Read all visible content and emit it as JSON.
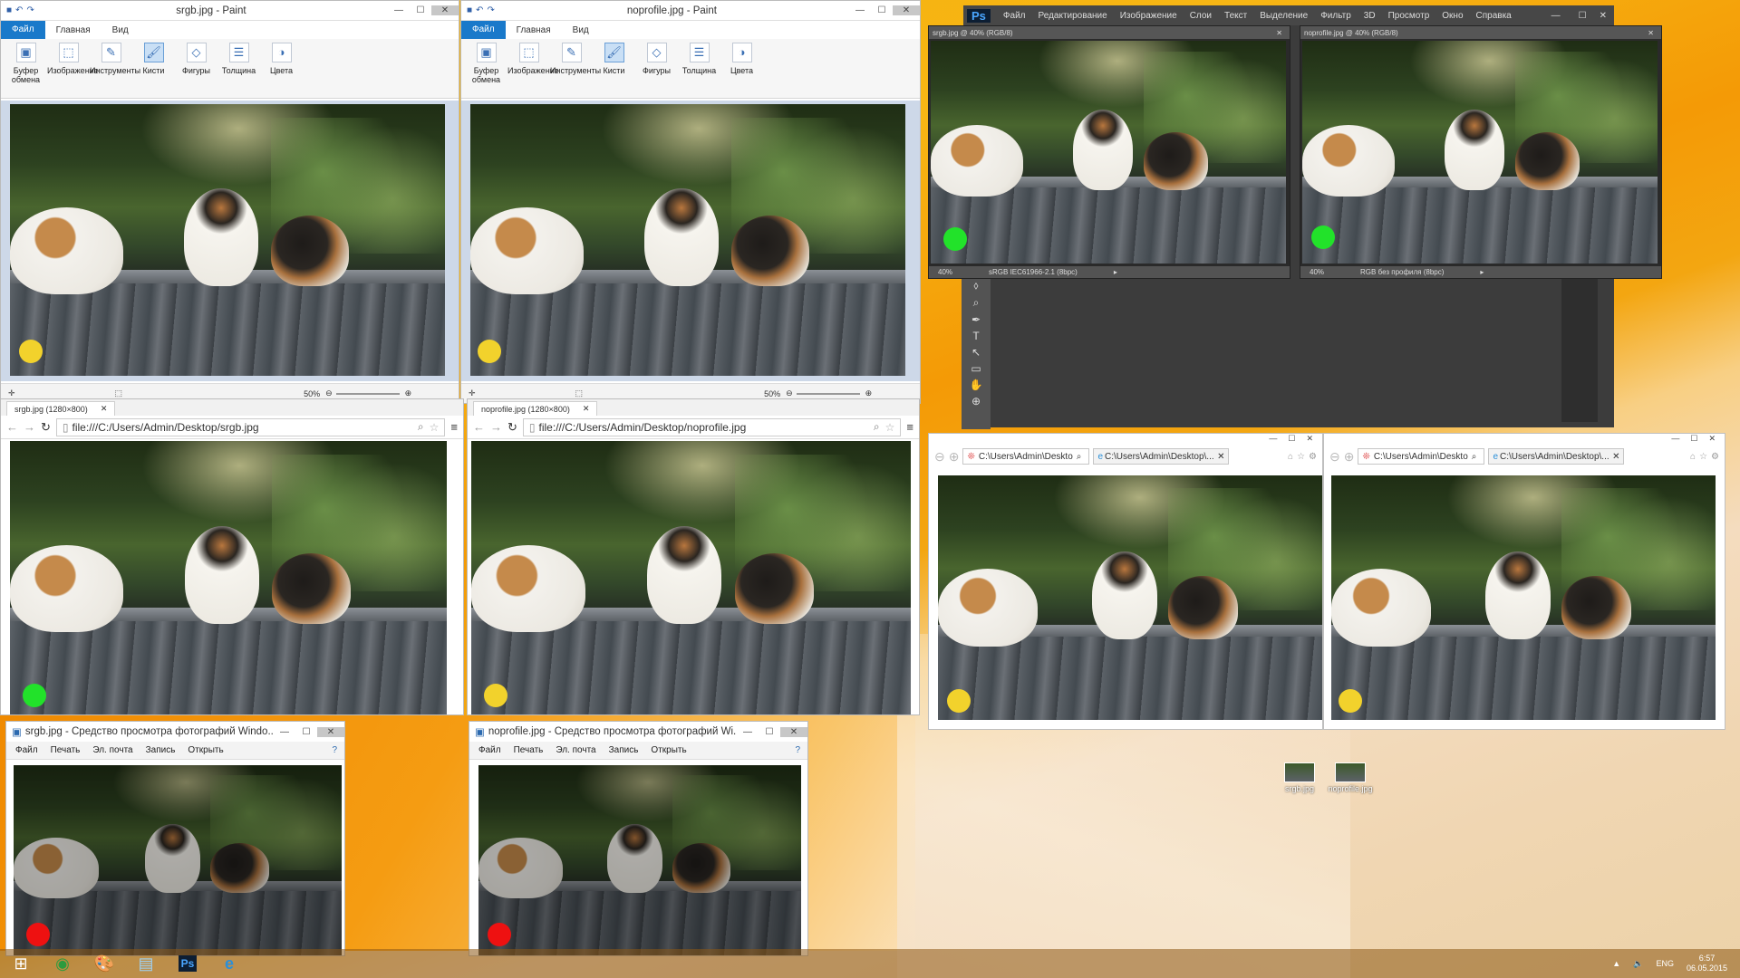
{
  "paint": [
    {
      "title": "srgb.jpg - Paint",
      "dot": "#f2d22c"
    },
    {
      "title": "noprofile.jpg - Paint",
      "dot": "#f2d22c"
    }
  ],
  "paint_tabs": {
    "file": "Файл",
    "home": "Главная",
    "view": "Вид"
  },
  "paint_ribbon": [
    {
      "icon": "clipboard-icon",
      "label": "Буфер обмена"
    },
    {
      "icon": "image-icon",
      "label": "Изображение"
    },
    {
      "icon": "tools-icon",
      "label": "Инструменты"
    },
    {
      "icon": "brush-icon",
      "label": "Кисти"
    },
    {
      "icon": "shapes-icon",
      "label": "Фигуры"
    },
    {
      "icon": "size-icon",
      "label": "Толщина"
    },
    {
      "icon": "colors-icon",
      "label": "Цвета"
    }
  ],
  "paint_zoom": "50%",
  "browser": [
    {
      "tab": "srgb.jpg (1280×800)",
      "url": "file:///C:/Users/Admin/Desktop/srgb.jpg",
      "dot": "#22e22a"
    },
    {
      "tab": "noprofile.jpg (1280×800)",
      "url": "file:///C:/Users/Admin/Desktop/noprofile.jpg",
      "dot": "#f2d22c"
    }
  ],
  "viewer": [
    {
      "title": "srgb.jpg - Средство просмотра фотографий Windo...",
      "dot": "#ee1111"
    },
    {
      "title": "noprofile.jpg - Средство просмотра фотографий Wi...",
      "dot": "#ee1111"
    }
  ],
  "viewer_menu": [
    "Файл",
    "Печать",
    "Эл. почта",
    "Запись",
    "Открыть"
  ],
  "photoshop": {
    "logo": "Ps",
    "menu": [
      "Файл",
      "Редактирование",
      "Изображение",
      "Слои",
      "Текст",
      "Выделение",
      "Фильтр",
      "3D",
      "Просмотр",
      "Окно",
      "Справка"
    ],
    "docs": [
      {
        "title": "srgb.jpg @ 40% (RGB/8)",
        "zoom": "40%",
        "profile": "sRGB IEC61966-2.1 (8bpc)",
        "dot": "#22e22a"
      },
      {
        "title": "noprofile.jpg @ 40% (RGB/8)",
        "zoom": "40%",
        "profile": "RGB без профиля (8bpc)",
        "dot": "#22e22a"
      }
    ]
  },
  "ie": [
    {
      "addr": "C:\\Users\\Admin\\Deskto",
      "tab": "C:\\Users\\Admin\\Desktop\\...",
      "dot": "#f2d22c"
    },
    {
      "addr": "C:\\Users\\Admin\\Deskto",
      "tab": "C:\\Users\\Admin\\Desktop\\...",
      "dot": "#f2d22c"
    }
  ],
  "desktop_icons": [
    {
      "label": "srgb.jpg"
    },
    {
      "label": "noprofile.jpg"
    }
  ],
  "tray": {
    "lang": "ENG",
    "time": "6:57",
    "date": "06.05.2015"
  }
}
